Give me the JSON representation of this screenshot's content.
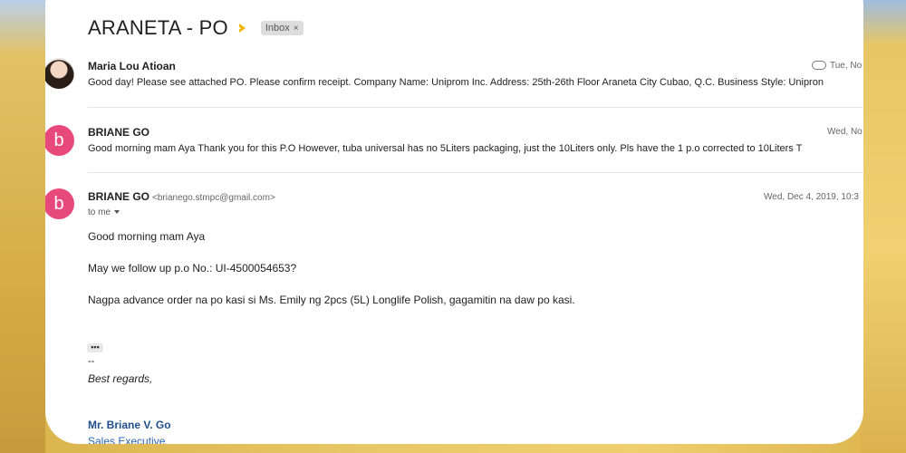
{
  "thread": {
    "subject": "ARANETA - PO",
    "label": "Inbox",
    "label_remove": "×"
  },
  "messages": [
    {
      "sender": "Maria Lou Atioan",
      "snippet": "Good day! Please see attached PO. Please confirm receipt. Company Name: Uniprom Inc. Address: 25th-26th Floor Araneta City Cubao, Q.C. Business Style: Unipron",
      "date": "Tue, No",
      "has_attachment": true,
      "avatar": "photo"
    },
    {
      "sender": "BRIANE GO",
      "avatar_letter": "b",
      "snippet": "Good morning mam Aya Thank you for this P.O However, tuba universal has no 5Liters packaging, just the 10Liters only. Pls have the 1 p.o corrected to 10Liters T",
      "date": "Wed, No"
    },
    {
      "sender": "BRIANE GO",
      "avatar_letter": "b",
      "email": "<brianego.stmpc@gmail.com>",
      "date": "Wed, Dec 4, 2019, 10:3",
      "recipient": "to me",
      "body": [
        "Good morning mam Aya",
        "May we follow up p.o No.: UI-4500054653?",
        "Nagpa advance order na po kasi si Ms. Emily ng 2pcs (5L) Longlife Polish, gagamitin na daw po kasi."
      ],
      "trimmed_content": "•••",
      "signature": {
        "dash": "--",
        "closing": "Best regards,",
        "name": "Mr. Briane V. Go",
        "title": "Sales Executive"
      }
    }
  ],
  "colors": {
    "avatar_pink": "#e8497d",
    "importance_marker": "#f2b600",
    "signature_blue": "#1f4e8c"
  }
}
